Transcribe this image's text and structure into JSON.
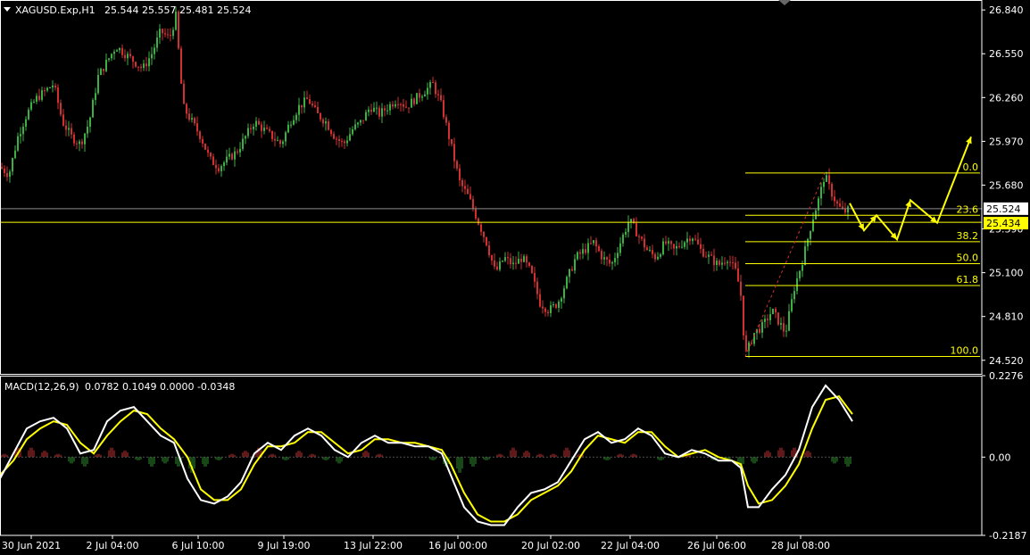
{
  "header": {
    "symbol": "XAGUSD.Exp,H1",
    "ohlc": "25.544 25.557 25.481 25.524"
  },
  "macd_header": {
    "label": "MACD(12,26,9)",
    "values": "0.0782 0.1049 0.0000 -0.0348"
  },
  "colors": {
    "background": "#000000",
    "bull_candle": "#3cb043",
    "bear_candle": "#d03030",
    "fib": "#ffff00",
    "price_line": "#8a8a8a",
    "support_line": "#ffff00",
    "macd_line": "#ffffff",
    "signal_line": "#ffff00",
    "hist_pos": "#c03030",
    "hist_neg": "#2e8b2e"
  },
  "chart_data": [
    {
      "type": "candlestick",
      "ylim": [
        24.43,
        26.9
      ],
      "y_ticks": [
        "26.840",
        "26.550",
        "26.260",
        "25.970",
        "25.680",
        "25.390",
        "25.100",
        "24.810",
        "24.520"
      ],
      "x_ticks": [
        "30 Jun 2021",
        "2 Jul 04:00",
        "6 Jul 10:00",
        "9 Jul 19:00",
        "13 Jul 22:00",
        "16 Jul 00:00",
        "20 Jul 02:00",
        "22 Jul 04:00",
        "26 Jul 06:00",
        "28 Jul 08:00"
      ],
      "current_price": "25.524",
      "support_price": "25.434",
      "support_value": 25.434,
      "current_value": 25.524,
      "path_points": [
        [
          0,
          25.8
        ],
        [
          10,
          25.75
        ],
        [
          20,
          26.0
        ],
        [
          30,
          26.15
        ],
        [
          40,
          26.25
        ],
        [
          50,
          26.3
        ],
        [
          60,
          26.35
        ],
        [
          70,
          26.1
        ],
        [
          80,
          26.0
        ],
        [
          90,
          25.95
        ],
        [
          100,
          26.1
        ],
        [
          110,
          26.4
        ],
        [
          120,
          26.5
        ],
        [
          130,
          26.6
        ],
        [
          140,
          26.55
        ],
        [
          150,
          26.5
        ],
        [
          160,
          26.45
        ],
        [
          170,
          26.55
        ],
        [
          180,
          26.7
        ],
        [
          190,
          26.65
        ],
        [
          197,
          26.8
        ],
        [
          205,
          26.2
        ],
        [
          215,
          26.1
        ],
        [
          225,
          26.0
        ],
        [
          235,
          25.85
        ],
        [
          245,
          25.8
        ],
        [
          255,
          25.85
        ],
        [
          265,
          25.9
        ],
        [
          275,
          26.0
        ],
        [
          285,
          26.1
        ],
        [
          295,
          26.05
        ],
        [
          305,
          26.0
        ],
        [
          315,
          25.95
        ],
        [
          325,
          26.1
        ],
        [
          335,
          26.2
        ],
        [
          345,
          26.25
        ],
        [
          355,
          26.15
        ],
        [
          365,
          26.1
        ],
        [
          375,
          26.0
        ],
        [
          385,
          25.95
        ],
        [
          395,
          26.05
        ],
        [
          405,
          26.1
        ],
        [
          415,
          26.2
        ],
        [
          425,
          26.15
        ],
        [
          435,
          26.2
        ],
        [
          445,
          26.25
        ],
        [
          455,
          26.2
        ],
        [
          465,
          26.25
        ],
        [
          475,
          26.3
        ],
        [
          485,
          26.35
        ],
        [
          495,
          26.2
        ],
        [
          505,
          25.95
        ],
        [
          515,
          25.7
        ],
        [
          525,
          25.6
        ],
        [
          535,
          25.45
        ],
        [
          545,
          25.3
        ],
        [
          555,
          25.1
        ],
        [
          565,
          25.2
        ],
        [
          575,
          25.15
        ],
        [
          585,
          25.2
        ],
        [
          595,
          25.1
        ],
        [
          605,
          24.9
        ],
        [
          615,
          24.85
        ],
        [
          625,
          24.9
        ],
        [
          635,
          25.05
        ],
        [
          645,
          25.2
        ],
        [
          655,
          25.25
        ],
        [
          665,
          25.3
        ],
        [
          675,
          25.2
        ],
        [
          685,
          25.15
        ],
        [
          695,
          25.3
        ],
        [
          705,
          25.45
        ],
        [
          715,
          25.35
        ],
        [
          725,
          25.25
        ],
        [
          735,
          25.2
        ],
        [
          745,
          25.3
        ],
        [
          755,
          25.25
        ],
        [
          765,
          25.3
        ],
        [
          775,
          25.35
        ],
        [
          785,
          25.25
        ],
        [
          795,
          25.2
        ],
        [
          805,
          25.15
        ],
        [
          815,
          25.2
        ],
        [
          825,
          25.1
        ],
        [
          830,
          24.95
        ],
        [
          835,
          24.55
        ],
        [
          845,
          24.7
        ],
        [
          855,
          24.75
        ],
        [
          865,
          24.85
        ],
        [
          875,
          24.75
        ],
        [
          880,
          24.7
        ],
        [
          890,
          25.0
        ],
        [
          900,
          25.2
        ],
        [
          910,
          25.45
        ],
        [
          918,
          25.6
        ],
        [
          924,
          25.75
        ],
        [
          930,
          25.65
        ],
        [
          938,
          25.55
        ],
        [
          945,
          25.5
        ],
        [
          952,
          25.52
        ]
      ],
      "fib_levels": [
        {
          "label": "0.0",
          "value": 25.76
        },
        {
          "label": "23.6",
          "value": 25.48
        },
        {
          "label": "38.2",
          "value": 25.305
        },
        {
          "label": "50.0",
          "value": 25.16
        },
        {
          "label": "61.8",
          "value": 25.015
        },
        {
          "label": "100.0",
          "value": 24.545
        }
      ],
      "forecast_path": [
        [
          952,
          25.56
        ],
        [
          968,
          25.38
        ],
        [
          982,
          25.48
        ],
        [
          1005,
          25.32
        ],
        [
          1020,
          25.58
        ],
        [
          1050,
          25.43
        ],
        [
          1088,
          26.0
        ]
      ]
    },
    {
      "type": "macd",
      "ylim": [
        -0.2187,
        0.2276
      ],
      "y_ticks": [
        "0.2276",
        "0.00",
        "-0.2187"
      ],
      "macd_points": [
        [
          0,
          -0.06
        ],
        [
          15,
          0.01
        ],
        [
          30,
          0.08
        ],
        [
          45,
          0.1
        ],
        [
          60,
          0.11
        ],
        [
          75,
          0.08
        ],
        [
          90,
          0.01
        ],
        [
          105,
          0.02
        ],
        [
          120,
          0.1
        ],
        [
          135,
          0.13
        ],
        [
          150,
          0.14
        ],
        [
          165,
          0.1
        ],
        [
          180,
          0.06
        ],
        [
          195,
          0.04
        ],
        [
          210,
          -0.06
        ],
        [
          225,
          -0.12
        ],
        [
          240,
          -0.13
        ],
        [
          255,
          -0.11
        ],
        [
          270,
          -0.07
        ],
        [
          285,
          0.01
        ],
        [
          300,
          0.04
        ],
        [
          315,
          0.02
        ],
        [
          330,
          0.06
        ],
        [
          345,
          0.08
        ],
        [
          360,
          0.06
        ],
        [
          375,
          0.02
        ],
        [
          390,
          0.0
        ],
        [
          405,
          0.04
        ],
        [
          420,
          0.06
        ],
        [
          435,
          0.04
        ],
        [
          450,
          0.04
        ],
        [
          465,
          0.03
        ],
        [
          480,
          0.03
        ],
        [
          495,
          0.01
        ],
        [
          505,
          -0.05
        ],
        [
          520,
          -0.14
        ],
        [
          535,
          -0.18
        ],
        [
          550,
          -0.19
        ],
        [
          565,
          -0.19
        ],
        [
          580,
          -0.14
        ],
        [
          595,
          -0.1
        ],
        [
          610,
          -0.09
        ],
        [
          625,
          -0.07
        ],
        [
          640,
          -0.01
        ],
        [
          655,
          0.05
        ],
        [
          670,
          0.07
        ],
        [
          685,
          0.04
        ],
        [
          700,
          0.05
        ],
        [
          715,
          0.08
        ],
        [
          730,
          0.06
        ],
        [
          745,
          0.01
        ],
        [
          760,
          0.0
        ],
        [
          775,
          0.02
        ],
        [
          790,
          0.01
        ],
        [
          805,
          -0.01
        ],
        [
          820,
          -0.01
        ],
        [
          830,
          -0.03
        ],
        [
          838,
          -0.14
        ],
        [
          850,
          -0.14
        ],
        [
          865,
          -0.09
        ],
        [
          880,
          -0.05
        ],
        [
          895,
          0.02
        ],
        [
          910,
          0.14
        ],
        [
          925,
          0.2
        ],
        [
          940,
          0.16
        ],
        [
          955,
          0.1
        ]
      ],
      "signal_points": [
        [
          0,
          -0.05
        ],
        [
          15,
          -0.01
        ],
        [
          30,
          0.05
        ],
        [
          45,
          0.08
        ],
        [
          60,
          0.1
        ],
        [
          75,
          0.09
        ],
        [
          90,
          0.04
        ],
        [
          105,
          0.01
        ],
        [
          120,
          0.06
        ],
        [
          135,
          0.1
        ],
        [
          150,
          0.13
        ],
        [
          165,
          0.12
        ],
        [
          180,
          0.08
        ],
        [
          195,
          0.05
        ],
        [
          210,
          0.0
        ],
        [
          225,
          -0.09
        ],
        [
          240,
          -0.12
        ],
        [
          255,
          -0.12
        ],
        [
          270,
          -0.09
        ],
        [
          285,
          -0.02
        ],
        [
          300,
          0.03
        ],
        [
          315,
          0.03
        ],
        [
          330,
          0.04
        ],
        [
          345,
          0.07
        ],
        [
          360,
          0.07
        ],
        [
          375,
          0.04
        ],
        [
          390,
          0.01
        ],
        [
          405,
          0.02
        ],
        [
          420,
          0.05
        ],
        [
          435,
          0.05
        ],
        [
          450,
          0.04
        ],
        [
          465,
          0.04
        ],
        [
          480,
          0.03
        ],
        [
          495,
          0.02
        ],
        [
          505,
          -0.02
        ],
        [
          520,
          -0.1
        ],
        [
          535,
          -0.16
        ],
        [
          550,
          -0.18
        ],
        [
          565,
          -0.18
        ],
        [
          580,
          -0.16
        ],
        [
          595,
          -0.12
        ],
        [
          610,
          -0.1
        ],
        [
          625,
          -0.08
        ],
        [
          640,
          -0.04
        ],
        [
          655,
          0.02
        ],
        [
          670,
          0.06
        ],
        [
          685,
          0.05
        ],
        [
          700,
          0.04
        ],
        [
          715,
          0.07
        ],
        [
          730,
          0.07
        ],
        [
          745,
          0.03
        ],
        [
          760,
          0.0
        ],
        [
          775,
          0.01
        ],
        [
          790,
          0.02
        ],
        [
          805,
          0.0
        ],
        [
          820,
          -0.01
        ],
        [
          830,
          -0.02
        ],
        [
          838,
          -0.08
        ],
        [
          850,
          -0.13
        ],
        [
          865,
          -0.12
        ],
        [
          880,
          -0.08
        ],
        [
          895,
          -0.02
        ],
        [
          910,
          0.08
        ],
        [
          925,
          0.16
        ],
        [
          940,
          0.17
        ],
        [
          955,
          0.12
        ]
      ],
      "hist_points": [
        [
          5,
          0.01
        ],
        [
          20,
          0.03
        ],
        [
          35,
          0.03
        ],
        [
          50,
          0.02
        ],
        [
          65,
          0.01
        ],
        [
          80,
          -0.02
        ],
        [
          95,
          -0.03
        ],
        [
          110,
          0.01
        ],
        [
          125,
          0.03
        ],
        [
          140,
          0.02
        ],
        [
          155,
          -0.01
        ],
        [
          170,
          -0.03
        ],
        [
          185,
          -0.02
        ],
        [
          200,
          -0.03
        ],
        [
          215,
          -0.05
        ],
        [
          230,
          -0.03
        ],
        [
          245,
          -0.01
        ],
        [
          260,
          0.01
        ],
        [
          275,
          0.02
        ],
        [
          290,
          0.03
        ],
        [
          305,
          0.01
        ],
        [
          320,
          -0.01
        ],
        [
          335,
          0.02
        ],
        [
          350,
          0.01
        ],
        [
          365,
          -0.01
        ],
        [
          380,
          -0.02
        ],
        [
          395,
          0.0
        ],
        [
          410,
          0.02
        ],
        [
          425,
          0.01
        ],
        [
          440,
          0.0
        ],
        [
          455,
          0.0
        ],
        [
          470,
          0.0
        ],
        [
          485,
          -0.01
        ],
        [
          500,
          -0.03
        ],
        [
          515,
          -0.05
        ],
        [
          530,
          -0.03
        ],
        [
          545,
          -0.01
        ],
        [
          560,
          0.01
        ],
        [
          575,
          0.03
        ],
        [
          590,
          0.02
        ],
        [
          605,
          0.01
        ],
        [
          620,
          0.01
        ],
        [
          635,
          0.03
        ],
        [
          650,
          0.01
        ],
        [
          665,
          0.0
        ],
        [
          680,
          -0.01
        ],
        [
          695,
          0.01
        ],
        [
          710,
          0.01
        ],
        [
          725,
          0.0
        ],
        [
          740,
          -0.01
        ],
        [
          755,
          0.0
        ],
        [
          770,
          0.01
        ],
        [
          785,
          0.0
        ],
        [
          800,
          -0.01
        ],
        [
          815,
          -0.01
        ],
        [
          830,
          -0.03
        ],
        [
          845,
          -0.02
        ],
        [
          860,
          0.02
        ],
        [
          875,
          0.03
        ],
        [
          890,
          0.03
        ],
        [
          905,
          0.02
        ],
        [
          920,
          0.0
        ],
        [
          935,
          -0.02
        ],
        [
          950,
          -0.03
        ]
      ]
    }
  ]
}
